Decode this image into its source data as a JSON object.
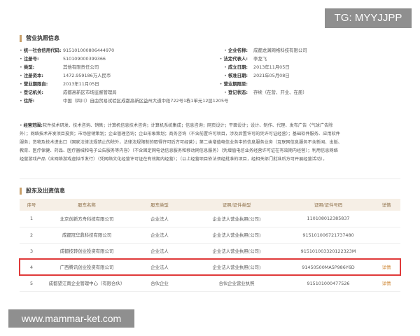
{
  "watermark": {
    "top": "TG: MYYJJPP",
    "bottom": "www.mammar-ket.com"
  },
  "license": {
    "title": "营业执照信息",
    "rows": [
      [
        {
          "label": "统一社会信用代码:",
          "value": "915101000806444970"
        },
        {
          "label": "企业名称:",
          "value": "成都龙渊网络科技有限公司"
        }
      ],
      [
        {
          "label": "注册号:",
          "value": "510109000399366"
        },
        {
          "label": "法定代表人:",
          "value": "李龙飞"
        }
      ],
      [
        {
          "label": "类型:",
          "value": "其他有限责任公司"
        },
        {
          "label": "成立日期:",
          "value": "2013年11月05日"
        }
      ],
      [
        {
          "label": "注册资本:",
          "value": "1472.959186万人民币"
        },
        {
          "label": "核准日期:",
          "value": "2021年05月08日"
        }
      ],
      [
        {
          "label": "营业期限自:",
          "value": "2013年11月05日"
        },
        {
          "label": "营业期限至:",
          "value": ""
        }
      ],
      [
        {
          "label": "登记机关:",
          "value": "成都高新区市场监督管理局"
        },
        {
          "label": "登记状态:",
          "value": "存续（在营、开业、在册）"
        }
      ],
      [
        {
          "label": "住所:",
          "value": "中国（四川）自由贸易试验区成都高新区益州大道中段722号1栋1单元12层1205号"
        },
        {
          "label": "",
          "value": ""
        }
      ]
    ],
    "scope_label": "经营范围:",
    "scope_lines": [
      "软件技术研发、技术咨询、销售；计算机信息技术咨询；计算机系统集成；信息咨询；网页设计；平面设计；设计、制作、代理、发布广告（气球广告除",
      "外）；网络技术开发项目投资；市场营销策划；企业管理咨询；企业形象策划；商务咨询（不含前置许可项目，涉及后置许可的凭许可证经营）；基础软件服务、应用软件",
      "服务；货物及技术进出口（国家法律法规禁止的除外，法律法规限制的取得许可后方可经营）；第二类增值电信业务中的信息服务业务（互联网信息服务不含新闻、出版、",
      "教育、医疗保健、药品、医疗器械和电子公告服务等内容）（不含固定网电话信息服务和移动网信息服务）（凭增值电信业务经营许可证在有效期内经营）；利用信息网络",
      "经营游戏产品（含网络游戏虚拟币发行）（凭网络文化经营许可证在有效期内经营）；（以上经营项目依法须经批准的项目，经相关部门批准后方可开展经营活动）。"
    ]
  },
  "shareholders": {
    "title": "股东及出资信息",
    "headers": [
      "序号",
      "股东名称",
      "股东类型",
      "证照/证件类型",
      "证照/证件号码",
      "详情"
    ],
    "rows": [
      {
        "idx": "1",
        "name": "北京创新方舟科技有限公司",
        "type": "企业法人",
        "cert": "企业法人营业执照(公司)",
        "no": "110108012385837",
        "detail": ""
      },
      {
        "idx": "2",
        "name": "成都冠华鼎科技有限公司",
        "type": "企业法人",
        "cert": "企业法人营业执照(公司)",
        "no": "915101006721737480",
        "detail": ""
      },
      {
        "idx": "3",
        "name": "成都技转创业投资有限公司",
        "type": "企业法人",
        "cert": "企业法人营业执照(公司)",
        "no": "915101003320122323M",
        "detail": ""
      },
      {
        "idx": "4",
        "name": "广西腾讯创业投资有限公司",
        "type": "企业法人",
        "cert": "企业法人营业执照(公司)",
        "no": "91450500MA5P986Y6D",
        "detail": "详情"
      },
      {
        "idx": "5",
        "name": "成都望江南企业管理中心（有限合伙）",
        "type": "合伙企业",
        "cert": "合伙企业营业执照",
        "no": "915101000477526",
        "detail": "详情"
      }
    ]
  },
  "colors": {
    "accent": "#c9a06a",
    "highlight": "#e03a3a",
    "link": "#d08a3a",
    "header_bg": "#f6efe6"
  }
}
